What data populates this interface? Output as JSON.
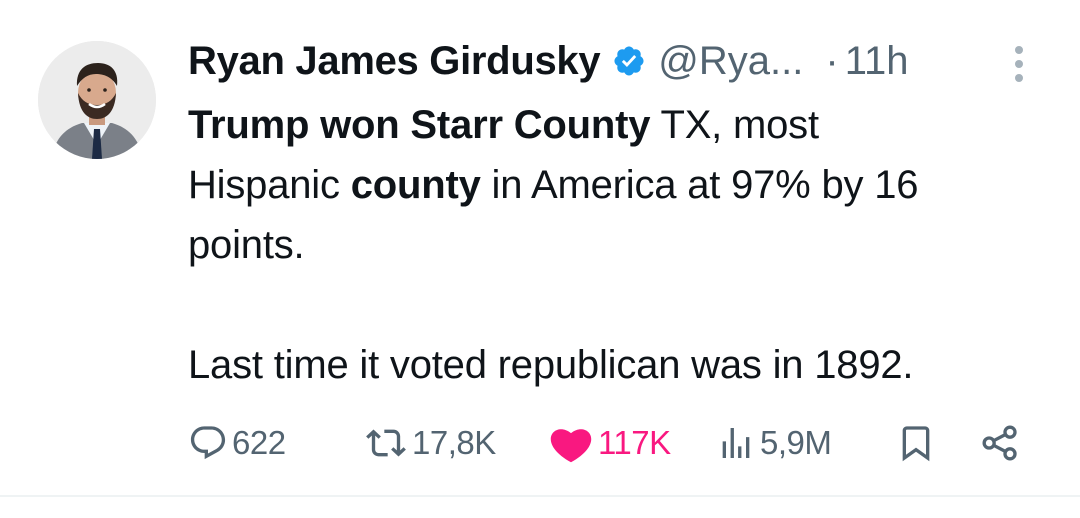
{
  "author": {
    "name": "Ryan James Girdusky",
    "handle": "@Rya...",
    "separator": "·",
    "time": "11h",
    "verified_color": "#1d9bf0"
  },
  "tweet": {
    "line1_bold": "Trump won Starr County",
    "line1_rest": " TX, most",
    "line2_pre": "Hispanic ",
    "line2_bold": "county",
    "line2_post": " in America at 97% by 16",
    "line3": "points.",
    "line4": "Last time it voted republican was in 1892."
  },
  "actions": {
    "replies": "622",
    "retweets": "17,8K",
    "likes": "117K",
    "views": "5,9M",
    "like_color": "#f91880"
  },
  "icons": {
    "reply": "reply-icon",
    "retweet": "retweet-icon",
    "like": "heart-icon",
    "views": "views-icon",
    "bookmark": "bookmark-icon",
    "share": "share-icon",
    "more": "more-icon",
    "verified": "verified-badge-icon"
  }
}
